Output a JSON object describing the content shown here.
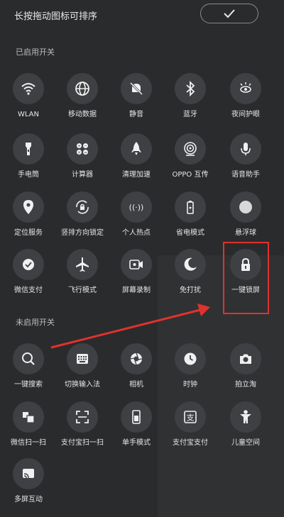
{
  "header": {
    "title": "长按拖动图标可排序",
    "confirm_icon": "check-icon"
  },
  "sections": {
    "enabled": "已启用开关",
    "disabled": "未启用开关"
  },
  "enabled_tiles": [
    {
      "label": "WLAN",
      "icon": "wifi-icon"
    },
    {
      "label": "移动数据",
      "icon": "globe-icon"
    },
    {
      "label": "静音",
      "icon": "mute-bell-icon"
    },
    {
      "label": "蓝牙",
      "icon": "bluetooth-icon"
    },
    {
      "label": "夜间护眼",
      "icon": "eye-sun-icon"
    },
    {
      "label": "手电筒",
      "icon": "flashlight-icon"
    },
    {
      "label": "计算器",
      "icon": "calculator-icon"
    },
    {
      "label": "清理加速",
      "icon": "rocket-icon"
    },
    {
      "label": "OPPO 互传",
      "icon": "share-target-icon"
    },
    {
      "label": "语音助手",
      "icon": "microphone-icon"
    },
    {
      "label": "定位服务",
      "icon": "location-pin-icon"
    },
    {
      "label": "竖排方向锁定",
      "icon": "rotation-lock-icon"
    },
    {
      "label": "个人热点",
      "icon": "hotspot-icon"
    },
    {
      "label": "省电模式",
      "icon": "battery-saver-icon"
    },
    {
      "label": "悬浮球",
      "icon": "floating-ball-icon"
    },
    {
      "label": "微信支付",
      "icon": "wechat-pay-icon"
    },
    {
      "label": "飞行模式",
      "icon": "airplane-icon"
    },
    {
      "label": "屏幕录制",
      "icon": "screen-record-icon"
    },
    {
      "label": "免打扰",
      "icon": "moon-icon"
    },
    {
      "label": "一键锁屏",
      "icon": "padlock-icon"
    }
  ],
  "disabled_tiles": [
    {
      "label": "一键搜索",
      "icon": "search-icon"
    },
    {
      "label": "切换输入法",
      "icon": "keyboard-icon"
    },
    {
      "label": "相机",
      "icon": "camera-aperture-icon"
    },
    {
      "label": "时钟",
      "icon": "clock-icon"
    },
    {
      "label": "拍立淘",
      "icon": "camera-icon"
    },
    {
      "label": "微信扫一扫",
      "icon": "wechat-scan-icon"
    },
    {
      "label": "支付宝扫一扫",
      "icon": "scan-frame-icon"
    },
    {
      "label": "单手模式",
      "icon": "one-hand-icon"
    },
    {
      "label": "支付宝支付",
      "icon": "alipay-icon"
    },
    {
      "label": "儿童空间",
      "icon": "child-figure-icon"
    },
    {
      "label": "多屏互动",
      "icon": "cast-screen-icon"
    }
  ],
  "colors": {
    "highlight": "#e0322d",
    "background": "#2a2b2d",
    "icon_bg": "#3f4043"
  }
}
